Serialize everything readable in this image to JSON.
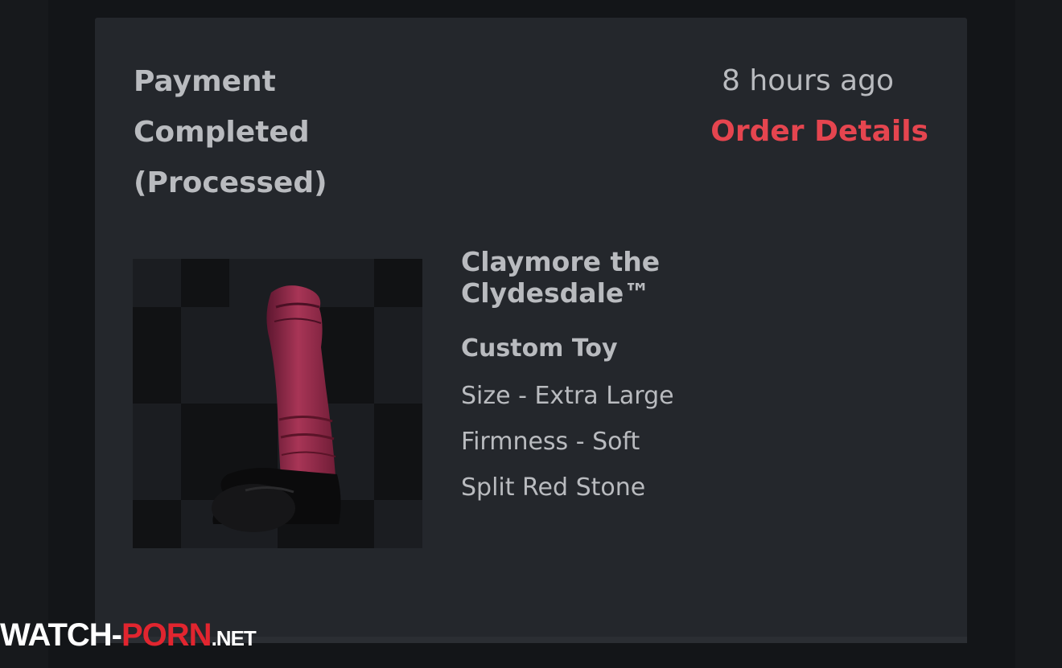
{
  "order": {
    "status_line1": "Payment",
    "status_line2": "Completed",
    "status_line3": "(Processed)",
    "time_ago": "8 hours ago",
    "details_link": "Order Details"
  },
  "product": {
    "name_line1": "Claymore the",
    "name_line2": "Clydesdale™",
    "type": "Custom Toy",
    "options": [
      "Size - Extra Large",
      "Firmness - Soft",
      "Split Red Stone"
    ]
  },
  "watermark": {
    "part1": "WATCH-",
    "part2": "PORN",
    "part3": ".NET"
  },
  "colors": {
    "accent": "#e5454f",
    "card_background": "#24272c",
    "text": "#b9bbbf"
  }
}
